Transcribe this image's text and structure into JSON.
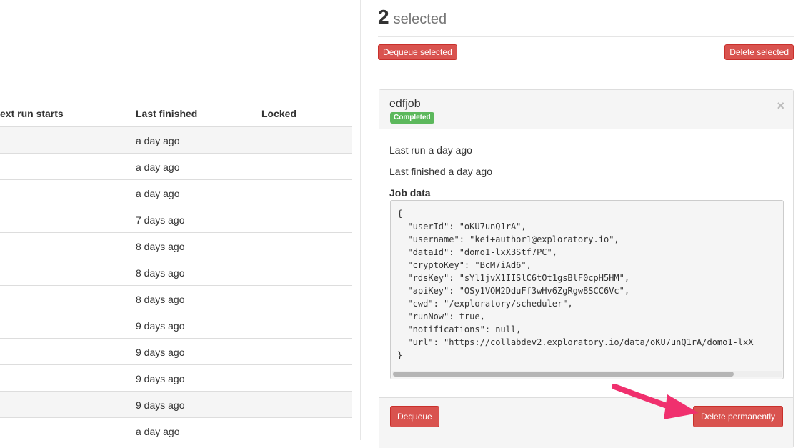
{
  "table": {
    "headers": [
      "ext run starts",
      "Last finished",
      "Locked"
    ],
    "rows": [
      "a day ago",
      "a day ago",
      "a day ago",
      "7 days ago",
      "8 days ago",
      "8 days ago",
      "8 days ago",
      "9 days ago",
      "9 days ago",
      "9 days ago",
      "9 days ago",
      "a day ago"
    ]
  },
  "selection": {
    "count": "2",
    "label": "selected",
    "dequeue_label": "Dequeue selected",
    "delete_label": "Delete selected"
  },
  "job": {
    "name": "edfjob",
    "status": "Completed",
    "last_run": "Last run a day ago",
    "last_finished": "Last finished a day ago",
    "data_label": "Job data",
    "data_lines": [
      "{",
      "  \"userId\": \"oKU7unQ1rA\",",
      "  \"username\": \"kei+author1@exploratory.io\",",
      "  \"dataId\": \"domo1-lxX3Stf7PC\",",
      "  \"cryptoKey\": \"BcM7iAd6\",",
      "  \"rdsKey\": \"sYl1jvX1IISlC6tOt1gsBlF0cpH5HM\",",
      "  \"apiKey\": \"OSy1VOM2DduFf3wHv6ZgRgw8SCC6Vc\",",
      "  \"cwd\": \"/exploratory/scheduler\",",
      "  \"runNow\": true,",
      "  \"notifications\": null,",
      "  \"url\": \"https://collabdev2.exploratory.io/data/oKU7unQ1rA/domo1-lxX",
      "}"
    ],
    "dequeue_label": "Dequeue",
    "delete_label": "Delete permanently"
  },
  "colors": {
    "danger": "#d9534f",
    "success": "#5cb85c",
    "arrow": "#f0306e"
  },
  "icons": {
    "close": "×"
  }
}
